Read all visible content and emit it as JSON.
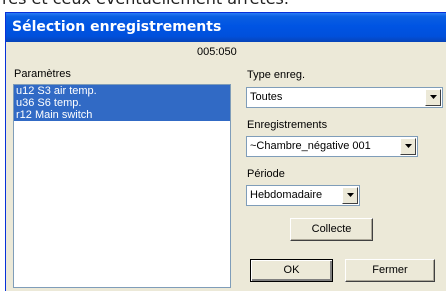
{
  "background": {
    "text": "res et ceux éventuellement arrêtés."
  },
  "window": {
    "title": "Sélection enregistrements",
    "titlebar_color": "#0054e3",
    "dialog_bg": "#ece9d8"
  },
  "header": {
    "id": "005:050"
  },
  "parameters": {
    "label": "Paramètres",
    "items": [
      "u12 S3 air temp.",
      "u36 S6 temp.",
      "r12 Main switch"
    ],
    "selected_color": "#316ac5"
  },
  "type_enreg": {
    "label": "Type enreg.",
    "value": "Toutes"
  },
  "enregistrements": {
    "label": "Enregistrements",
    "value": "~Chambre_négative 001"
  },
  "periode": {
    "label": "Période",
    "value": "Hebdomadaire"
  },
  "buttons": {
    "collecte": "Collecte",
    "ok": "OK",
    "fermer": "Fermer"
  }
}
